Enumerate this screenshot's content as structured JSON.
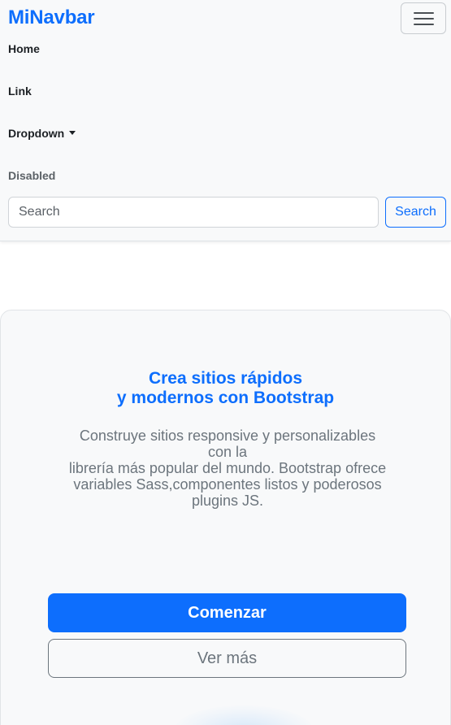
{
  "navbar": {
    "brand": "MiNavbar",
    "toggler_icon": "hamburger-icon",
    "links": {
      "home": "Home",
      "link": "Link",
      "dropdown": "Dropdown",
      "disabled": "Disabled"
    },
    "search": {
      "placeholder": "Search",
      "button_label": "Search"
    }
  },
  "hero": {
    "title_line1": "Crea sitios rápidos",
    "title_line2": "y modernos con Bootstrap",
    "lead_line1": "Construye sitios responsive y personalizables",
    "lead_line2": "con la",
    "lead_line3": "librería más popular del mundo. Bootstrap ofrece",
    "lead_line4": "variables Sass,componentes listos y poderosos",
    "lead_line5": "plugins JS.",
    "primary_button": "Comenzar",
    "secondary_button": "Ver más"
  },
  "colors": {
    "primary": "#0d6efd",
    "secondary": "#6c757d",
    "navbar_bg": "#f8f9fa"
  }
}
